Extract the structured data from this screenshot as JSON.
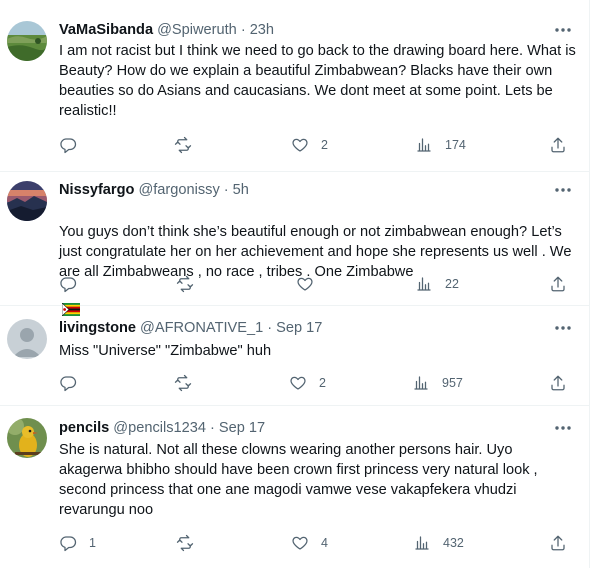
{
  "tweets": [
    {
      "name": "VaMaSibanda",
      "handle": "@Spiweruth",
      "time": "23h",
      "text": "I am not racist but I think we need to go back to the drawing board here. What is Beauty? How do we explain a beautiful Zimbabwean? Blacks have their own beauties so do Asians and caucasians. We dont meet at some point. Lets be realistic!!",
      "replies": "",
      "retweets": "",
      "likes": "2",
      "views": "174",
      "avatar_icon": "landscape-avatar"
    },
    {
      "name": "Nissyfargo",
      "handle": "@fargonissy",
      "time": "5h",
      "text": "You guys don’t think she’s beautiful enough or not zimbabwean enough? Let’s just congratulate her on her achievement and hope she represents us well . We are all Zimbabweans , no race , tribes . One Zimbabwe",
      "replies": "",
      "retweets": "",
      "likes": "",
      "views": "22",
      "avatar_icon": "sunset-avatar"
    },
    {
      "name": "livingstone",
      "handle": "@AFRONATIVE_1",
      "time": "Sep 17",
      "text": "Miss \"Universe\" \"Zimbabwe\" huh",
      "replies": "",
      "retweets": "",
      "likes": "2",
      "views": "957",
      "avatar_icon": "default-person-avatar"
    },
    {
      "name": "pencils",
      "handle": "@pencils1234",
      "time": "Sep 17",
      "text": "She is natural. Not all these clowns wearing another persons hair. Uyo akagerwa bhibho should have been crown first princess very natural look , second princess that one ane magodi vamwe vese vakapfekera vhudzi revarungu noo",
      "replies": "1",
      "retweets": "",
      "likes": "4",
      "views": "432",
      "avatar_icon": "bird-avatar"
    }
  ],
  "colors": {
    "text": "#0f1419",
    "secondary": "#536471",
    "divider": "#eff3f4"
  }
}
